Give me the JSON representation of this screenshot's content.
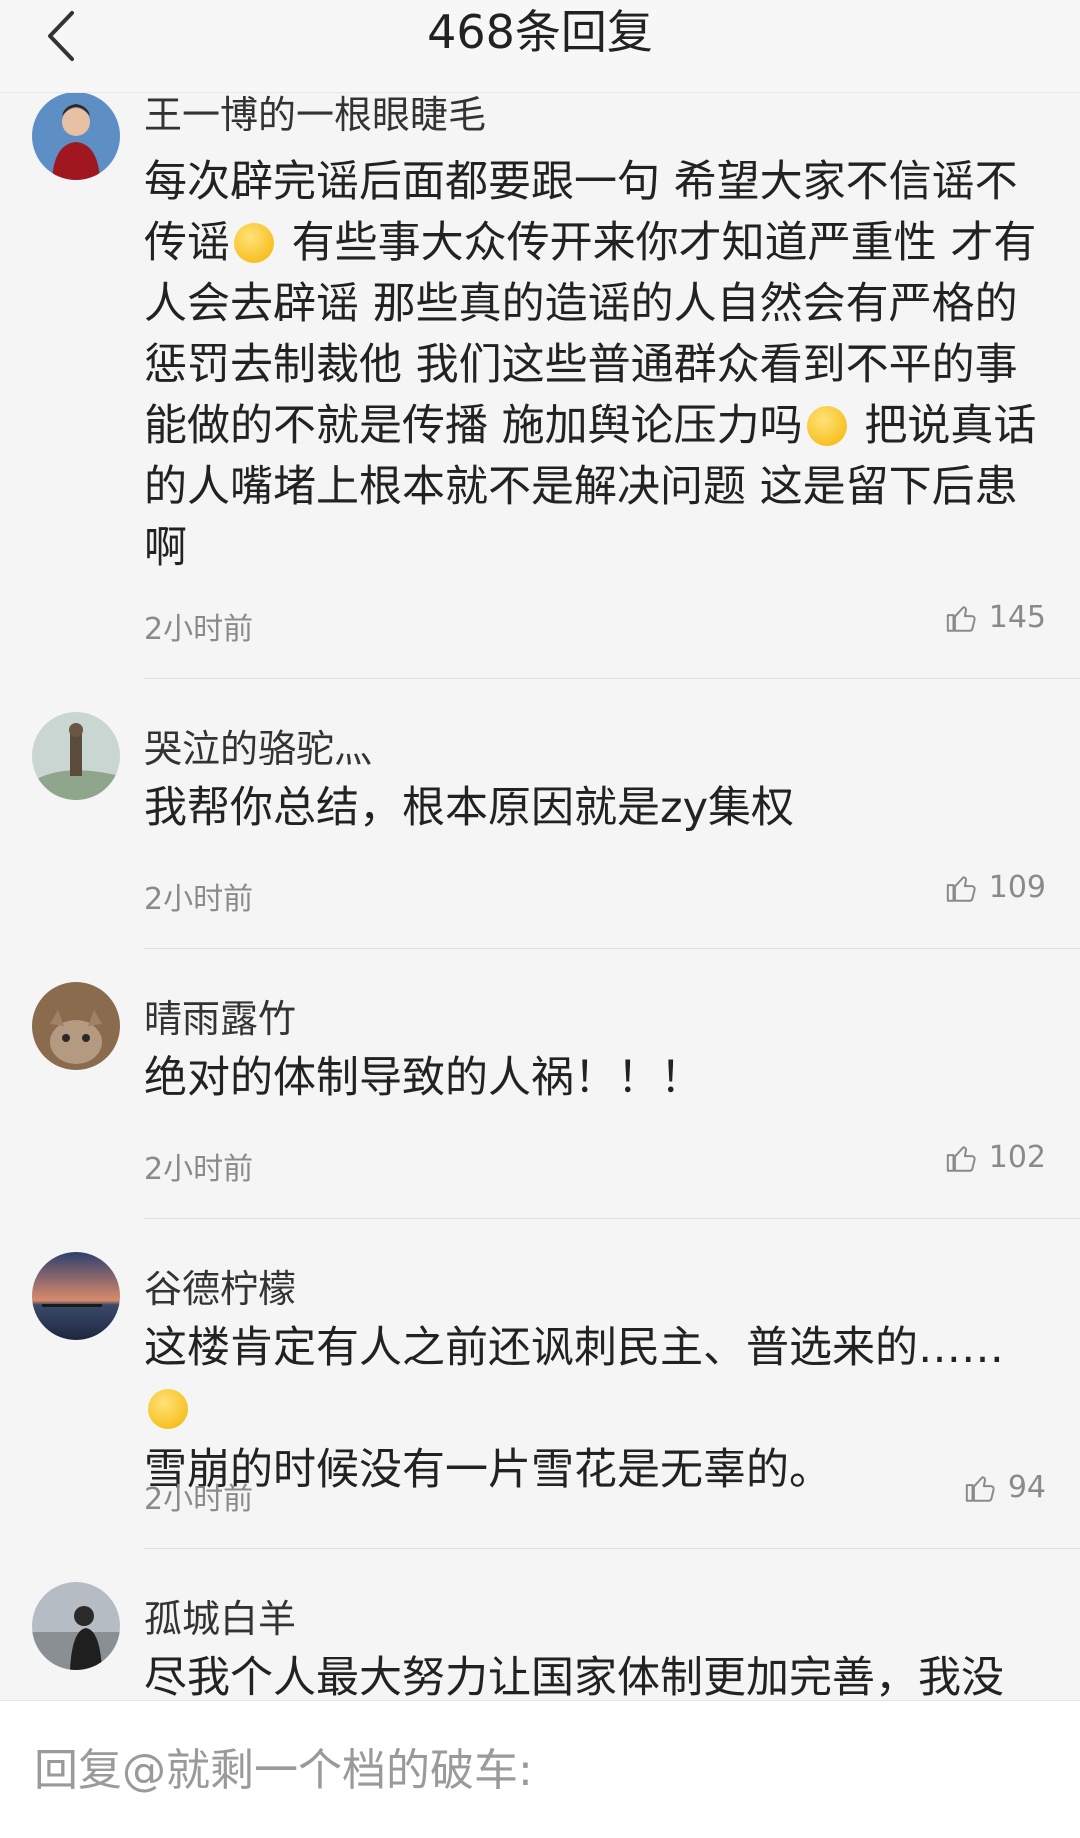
{
  "header": {
    "title": "468条回复"
  },
  "comments": [
    {
      "username": "王一博的一根眼睫毛",
      "text_parts": [
        "每次辟完谣后面都要跟一句 希望大家不信谣不传谣",
        " 有些事大众传开来你才知道严重性 才有人会去辟谣 那些真的造谣的人自然会有严格的惩罚去制裁他 我们这些普通群众看到不平的事能做的不就是传播 施加舆论压力吗",
        " 把说真话的人嘴堵上根本就不是解决问题 这是留下后患啊"
      ],
      "emojis": [
        "smile-emoji",
        "thinking-emoji"
      ],
      "time": "2小时前",
      "likes": "145"
    },
    {
      "username": "哭泣的骆驼灬",
      "text_parts": [
        "我帮你总结，根本原因就是zy集权"
      ],
      "time": "2小时前",
      "likes": "109"
    },
    {
      "username": "晴雨露竹",
      "text_parts": [
        "绝对的体制导致的人祸！！！"
      ],
      "time": "2小时前",
      "likes": "102"
    },
    {
      "username": "谷德柠檬",
      "text_parts": [
        "这楼肯定有人之前还讽刺民主、普选来的……",
        "雪崩的时候没有一片雪花是无辜的。"
      ],
      "emojis": [
        "shrug-emoji"
      ],
      "time": "2小时前",
      "likes": "94"
    },
    {
      "username": "孤城白羊",
      "text_parts": [
        "尽我个人最大努力让国家体制更加完善，我没"
      ]
    }
  ],
  "reply": {
    "placeholder": "回复@就剩一个档的破车:"
  },
  "colors": {
    "background": "#f5f5f5",
    "text": "#222222",
    "muted": "#8a8a8a"
  }
}
